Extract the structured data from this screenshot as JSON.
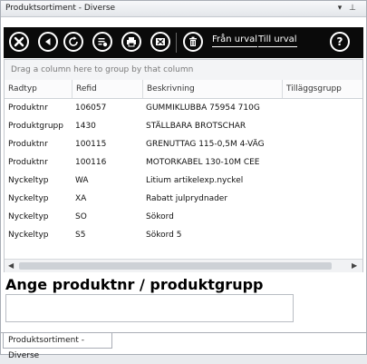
{
  "window": {
    "title": "Produktsortiment - Diverse",
    "pin_glyph": "▾",
    "pin2_glyph": "⊥"
  },
  "toolbar": {
    "buttons": [
      {
        "name": "close-icon"
      },
      {
        "name": "back-icon"
      },
      {
        "name": "refresh-icon"
      },
      {
        "name": "edit-list-icon"
      },
      {
        "name": "print-icon"
      },
      {
        "name": "excel-export-icon"
      },
      {
        "name": "delete-icon"
      },
      {
        "name": "help-icon"
      }
    ],
    "from_label": "Från urval",
    "to_label": "Till urval",
    "help_label": "?"
  },
  "grid": {
    "group_hint": "Drag a column here to group by that column",
    "columns": [
      "Radtyp",
      "Refid",
      "Beskrivning",
      "Tilläggsgrupp"
    ],
    "rows": [
      [
        "Produktnr",
        "106057",
        "GUMMIKLUBBA 75954 710G",
        ""
      ],
      [
        "Produktgrupp",
        "1430",
        "STÄLLBARA BROTSCHAR",
        ""
      ],
      [
        "Produktnr",
        "100115",
        "GRENUTTAG 115-0,5M 4-VÄG",
        ""
      ],
      [
        "Produktnr",
        "100116",
        "MOTORKABEL 130-10M CEE",
        ""
      ],
      [
        "Nyckeltyp",
        "WA",
        "Litium artikelexp.nyckel",
        ""
      ],
      [
        "Nyckeltyp",
        "XA",
        "Rabatt julprydnader",
        ""
      ],
      [
        "Nyckeltyp",
        "SO",
        "Sökord",
        ""
      ],
      [
        "Nyckeltyp",
        "S5",
        "Sökord 5",
        ""
      ]
    ]
  },
  "entry": {
    "label": "Ange produktnr / produktgrupp",
    "value": ""
  },
  "bottom_tab": {
    "label": "Produktsortiment - Diverse"
  }
}
